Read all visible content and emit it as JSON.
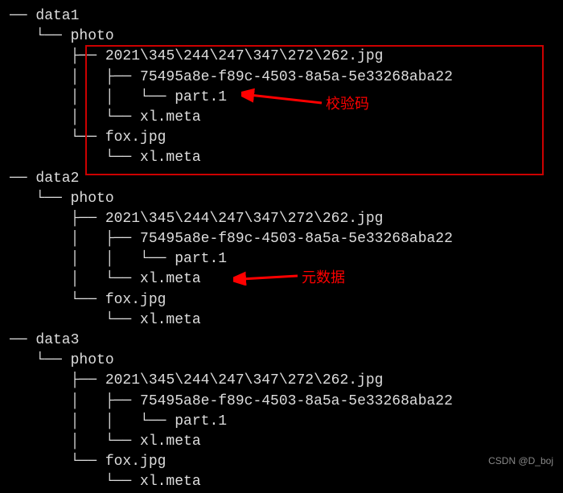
{
  "tree": {
    "data1": {
      "name": "data1",
      "photo": {
        "name": "photo",
        "file1": {
          "name": "2021\\345\\244\\247\\347\\272\\262.jpg",
          "uuid": "75495a8e-f89c-4503-8a5a-5e33268aba22",
          "part": "part.1",
          "meta": "xl.meta"
        },
        "file2": {
          "name": "fox.jpg",
          "meta": "xl.meta"
        }
      }
    },
    "data2": {
      "name": "data2",
      "photo": {
        "name": "photo",
        "file1": {
          "name": "2021\\345\\244\\247\\347\\272\\262.jpg",
          "uuid": "75495a8e-f89c-4503-8a5a-5e33268aba22",
          "part": "part.1",
          "meta": "xl.meta"
        },
        "file2": {
          "name": "fox.jpg",
          "meta": "xl.meta"
        }
      }
    },
    "data3": {
      "name": "data3",
      "photo": {
        "name": "photo",
        "file1": {
          "name": "2021\\345\\244\\247\\347\\272\\262.jpg",
          "uuid": "75495a8e-f89c-4503-8a5a-5e33268aba22",
          "part": "part.1",
          "meta": "xl.meta"
        },
        "file2": {
          "name": "fox.jpg",
          "meta": "xl.meta"
        }
      }
    }
  },
  "annotations": {
    "label1": "校验码",
    "label2": "元数据"
  },
  "watermark": "CSDN @D_boj",
  "glyphs": {
    "branch": "├──",
    "last": "└──",
    "pipe": "│"
  }
}
